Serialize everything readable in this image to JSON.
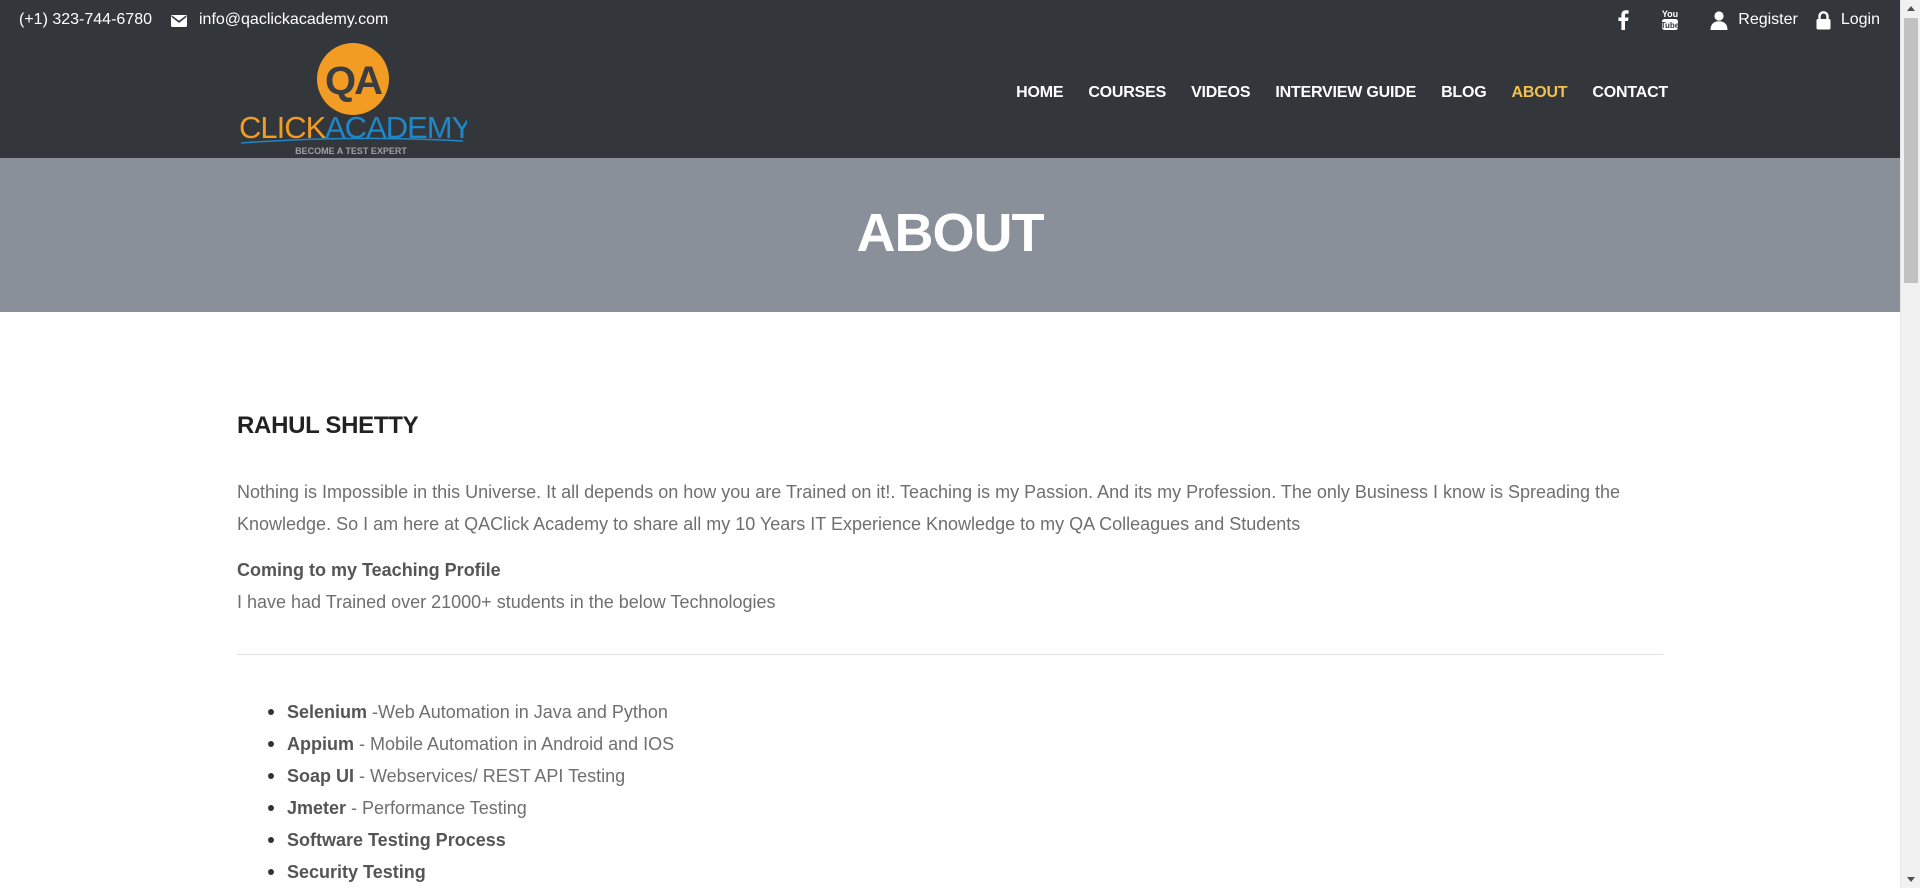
{
  "topbar": {
    "phone": "(+1) 323-744-6780",
    "email": "info@qaclickacademy.com",
    "icons": [
      "envelope-icon",
      "facebook-icon",
      "youtube-icon",
      "user-icon",
      "lock-icon"
    ],
    "register_label": "Register",
    "login_label": "Login"
  },
  "logo": {
    "badge_text": "QA",
    "word1": "CLICK",
    "word2": "ACADEMY",
    "tagline": "BECOME A TEST EXPERT"
  },
  "nav": {
    "items": [
      {
        "label": "HOME",
        "active": false
      },
      {
        "label": "COURSES",
        "active": false
      },
      {
        "label": "VIDEOS",
        "active": false
      },
      {
        "label": "INTERVIEW GUIDE",
        "active": false
      },
      {
        "label": "BLOG",
        "active": false
      },
      {
        "label": "ABOUT",
        "active": true
      },
      {
        "label": "CONTACT",
        "active": false
      }
    ]
  },
  "page_title": "ABOUT",
  "content": {
    "heading": "RAHUL SHETTY",
    "paragraph": "Nothing is Impossible in this Universe. It all depends on how you are Trained on it!. Teaching is my Passion. And its my Profession. The only Business I know is Spreading the Knowledge. So I am here at QAClick Academy to share all my 10 Years IT Experience Knowledge to my QA Colleagues and Students",
    "subheading": "Coming to my Teaching Profile",
    "trained_text": "I have had Trained over 21000+ students in the below Technologies",
    "technologies": [
      {
        "name": "Selenium",
        "desc": " -Web Automation in Java and Python"
      },
      {
        "name": "Appium",
        "desc": " - Mobile Automation in Android and IOS"
      },
      {
        "name": "Soap UI",
        "desc": " - Webservices/ REST API Testing"
      },
      {
        "name": "Jmeter",
        "desc": " - Performance Testing"
      },
      {
        "name": "Software Testing Process",
        "desc": ""
      },
      {
        "name": "Security Testing",
        "desc": ""
      }
    ]
  },
  "colors": {
    "header_bg": "#33363b",
    "title_band_bg": "#8a9099",
    "active_nav": "#f2c14e",
    "logo_orange": "#f39c23",
    "logo_blue": "#1e88c8"
  }
}
